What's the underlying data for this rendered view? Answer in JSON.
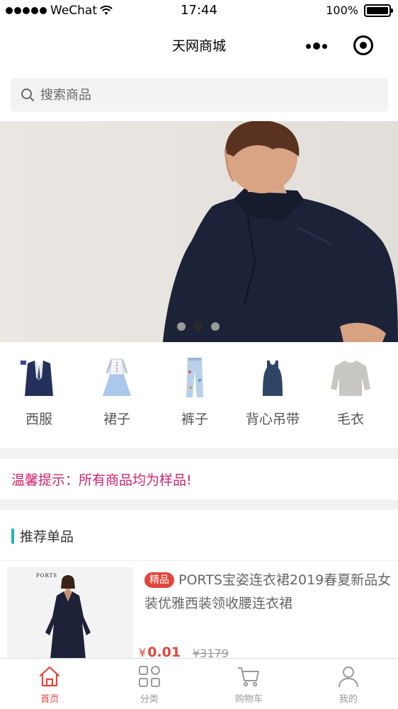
{
  "status_bar": {
    "carrier": "WeChat",
    "time": "17:44",
    "battery": "100%",
    "battery_level": 1.0
  },
  "nav": {
    "title": "天网商城",
    "more_icon": "more-dots-icon",
    "capsule_icon": "record-icon"
  },
  "search": {
    "placeholder": "搜索商品",
    "icon": "search-icon"
  },
  "banner": {
    "dots": 3,
    "active_index": 1
  },
  "categories": [
    {
      "label": "西服",
      "icon": "suit-icon"
    },
    {
      "label": "裙子",
      "icon": "dress-icon"
    },
    {
      "label": "裤子",
      "icon": "jeans-icon"
    },
    {
      "label": "背心吊带",
      "icon": "tank-top-icon"
    },
    {
      "label": "毛衣",
      "icon": "sweater-icon"
    }
  ],
  "notice": "温馨提示：所有商品均为样品!",
  "section": {
    "title": "推荐单品"
  },
  "products": [
    {
      "badge": "精品",
      "title": "PORTS宝姿连衣裙2019春夏新品女装优雅西装领收腰连衣裙",
      "brand_mark": "PORTS",
      "currency": "¥",
      "price": "0.01",
      "original_price": "¥3179"
    }
  ],
  "tabs": [
    {
      "label": "首页",
      "icon": "home-icon",
      "active": true
    },
    {
      "label": "分类",
      "icon": "category-icon",
      "active": false
    },
    {
      "label": "购物车",
      "icon": "cart-icon",
      "active": false
    },
    {
      "label": "我的",
      "icon": "user-icon",
      "active": false
    }
  ],
  "colors": {
    "accent": "#e2453c",
    "notice": "#d0226a",
    "section_bar": "#1fb8b8"
  }
}
